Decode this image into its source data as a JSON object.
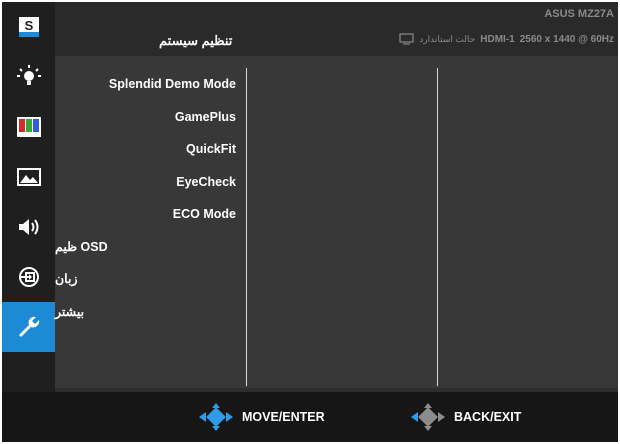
{
  "header": {
    "title": "تنظیم سیستم",
    "model": "ASUS MZ27A",
    "input": "HDMI-1",
    "resolution": "2560 x 1440 @ 60Hz",
    "mode_label": "حالت استاندارد"
  },
  "sidebar": {
    "items": [
      {
        "icon": "splendid-s-icon",
        "active": false
      },
      {
        "icon": "blue-light-icon",
        "active": false
      },
      {
        "icon": "color-bars-icon",
        "active": false
      },
      {
        "icon": "image-icon",
        "active": false
      },
      {
        "icon": "speaker-icon",
        "active": false
      },
      {
        "icon": "input-select-icon",
        "active": false
      },
      {
        "icon": "wrench-icon",
        "active": true
      }
    ]
  },
  "menu": {
    "items": [
      {
        "label": "Splendid Demo Mode"
      },
      {
        "label": "GamePlus"
      },
      {
        "label": "QuickFit"
      },
      {
        "label": "EyeCheck"
      },
      {
        "label": "ECO Mode"
      },
      {
        "label": "OSD ظیم"
      },
      {
        "label": "زبان"
      },
      {
        "label": "بیشتر"
      }
    ]
  },
  "footer": {
    "move_label": "MOVE/ENTER",
    "back_label": "BACK/EXIT"
  },
  "colors": {
    "accent": "#1d8ad6",
    "background": "#383838",
    "sidebar": "#1f1f1f",
    "footer": "#161616"
  }
}
